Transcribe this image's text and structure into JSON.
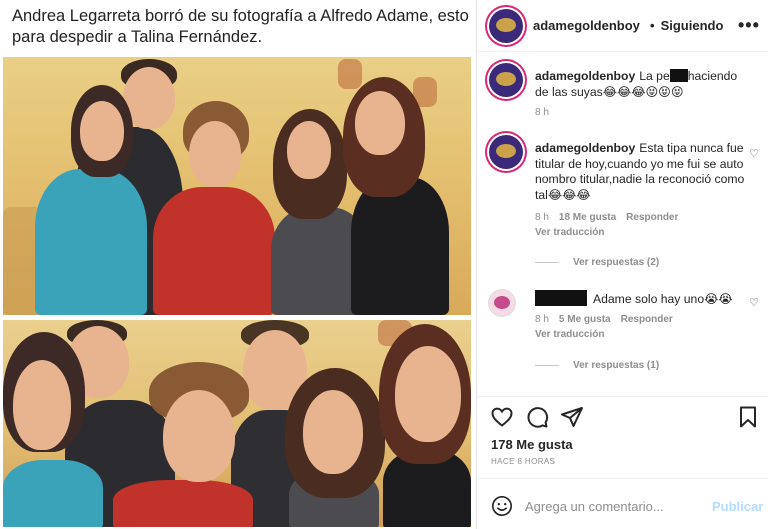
{
  "caption": "Andrea Legarreta borró de su fotografía a Alfredo Adame, esto para despedir a Talina Fernández.",
  "header": {
    "username": "adamegoldenboy",
    "separator": "•",
    "follow_status": "Siguiendo",
    "more": "•••"
  },
  "comments": [
    {
      "username": "adamegoldenboy",
      "text_before": "La pe",
      "text_after": "haciendo de las suyas😂😂😂😝😝😝",
      "time": "8 h"
    },
    {
      "username": "adamegoldenboy",
      "text": "Esta tipa nunca fue titular de hoy,cuando yo me fui se auto nombro titular,nadie la reconoció como tal😂😂😂",
      "time": "8 h",
      "likes": "18 Me gusta",
      "reply": "Responder",
      "translate": "Ver traducción",
      "view_replies": "Ver respuestas (2)"
    },
    {
      "text": "Adame solo hay uno😭😭",
      "time": "8 h",
      "likes": "5 Me gusta",
      "reply": "Responder",
      "translate": "Ver traducción",
      "view_replies": "Ver respuestas (1)"
    }
  ],
  "post": {
    "likes": "178 Me gusta",
    "time_ago": "HACE 8 HORAS"
  },
  "comment_box": {
    "placeholder": "Agrega un comentario...",
    "publish": "Publicar"
  },
  "colors": {
    "text": "#262626",
    "secondary": "#8e8e8e",
    "publish_disabled": "#b3dbff",
    "ring": "#d62976"
  }
}
